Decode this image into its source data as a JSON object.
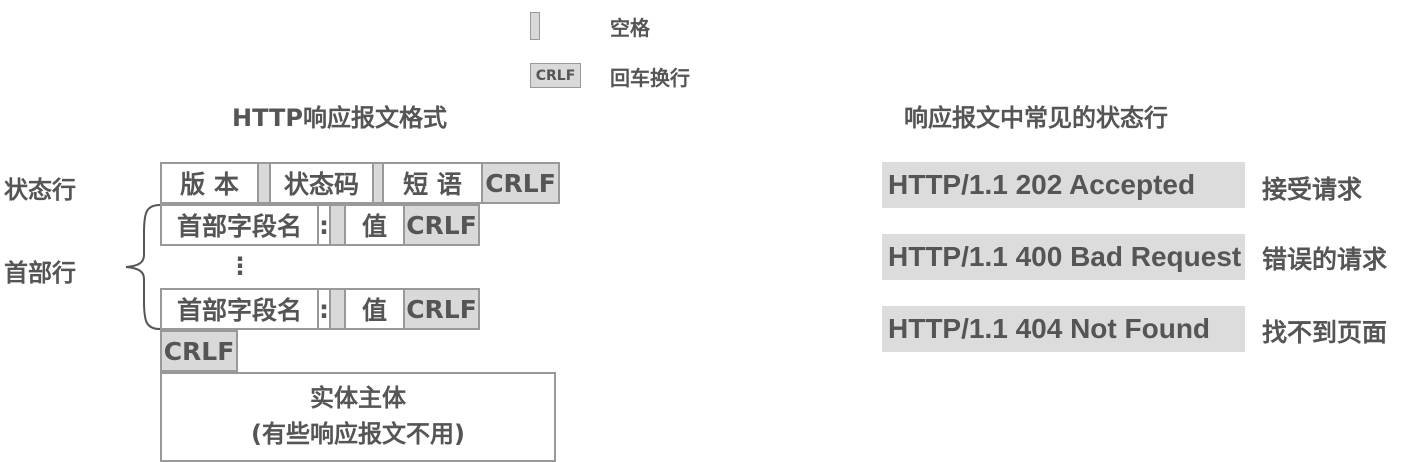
{
  "legend": {
    "space_label": "空格",
    "crlf_box": "CRLF",
    "crlf_label": "回车换行"
  },
  "left": {
    "title": "HTTP响应报文格式",
    "status_line_label": "状态行",
    "header_line_label": "首部行",
    "status_line": {
      "version": "版 本",
      "status_code": "状态码",
      "phrase": "短 语",
      "crlf": "CRLF"
    },
    "header": {
      "name": "首部字段名",
      "colon": ":",
      "value": "值",
      "crlf": "CRLF"
    },
    "ellipsis": "⋮",
    "blank_crlf": "CRLF",
    "body": {
      "title": "实体主体",
      "note": "(有些响应报文不用)"
    }
  },
  "right": {
    "title": "响应报文中常见的状态行",
    "rows": [
      {
        "line": "HTTP/1.1 202 Accepted",
        "desc": "接受请求"
      },
      {
        "line": "HTTP/1.1 400 Bad Request",
        "desc": "错误的请求"
      },
      {
        "line": "HTTP/1.1 404 Not Found",
        "desc": "找不到页面"
      }
    ]
  }
}
